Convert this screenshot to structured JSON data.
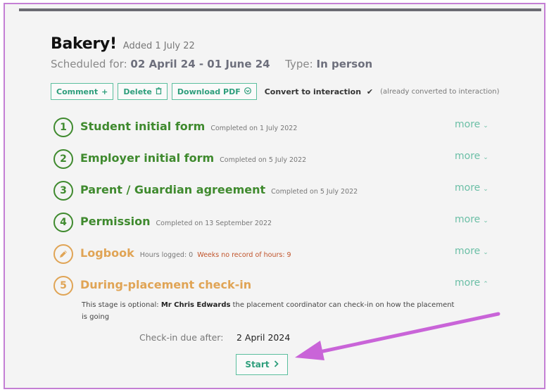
{
  "header": {
    "title": "Bakery!",
    "added": "Added 1 July 22",
    "scheduled_label": "Scheduled for:",
    "scheduled_value": "02 April 24 - 01 June 24",
    "type_label": "Type:",
    "type_value": "In person"
  },
  "actions": {
    "comment": "Comment",
    "delete": "Delete",
    "download_pdf": "Download PDF",
    "convert": "Convert to interaction",
    "already": "(already converted to interaction)"
  },
  "icons": {
    "comment": "+",
    "delete": "🗑",
    "download": "⊕",
    "convert_check": "✔",
    "chevron_down": "⌄",
    "chevron_up": "⌃",
    "start_chevron": "›",
    "pencil": "✎"
  },
  "more_label": "more",
  "stages": [
    {
      "num": "1",
      "title": "Student initial form",
      "meta": "Completed on 1 July 2022"
    },
    {
      "num": "2",
      "title": "Employer initial form",
      "meta": "Completed on 5 July 2022"
    },
    {
      "num": "3",
      "title": "Parent / Guardian agreement",
      "meta": "Completed on 5 July 2022"
    },
    {
      "num": "4",
      "title": "Permission",
      "meta": "Completed on 13 September 2022"
    }
  ],
  "logbook": {
    "title": "Logbook",
    "hours": "Hours logged: 0",
    "weeks": "Weeks no record of hours: 9"
  },
  "checkin": {
    "num": "5",
    "title": "During-placement check-in",
    "optional_prefix": "This stage is optional:",
    "coordinator": "Mr Chris Edwards",
    "optional_suffix": "the placement coordinator can check-in on how the placement is going",
    "due_label": "Check-in due after:",
    "due_value": "2 April 2024",
    "start": "Start"
  },
  "colors": {
    "green": "#3f8a2e",
    "orange": "#e0a455",
    "teal": "#2e9e7c",
    "arrow": "#c964d8"
  }
}
